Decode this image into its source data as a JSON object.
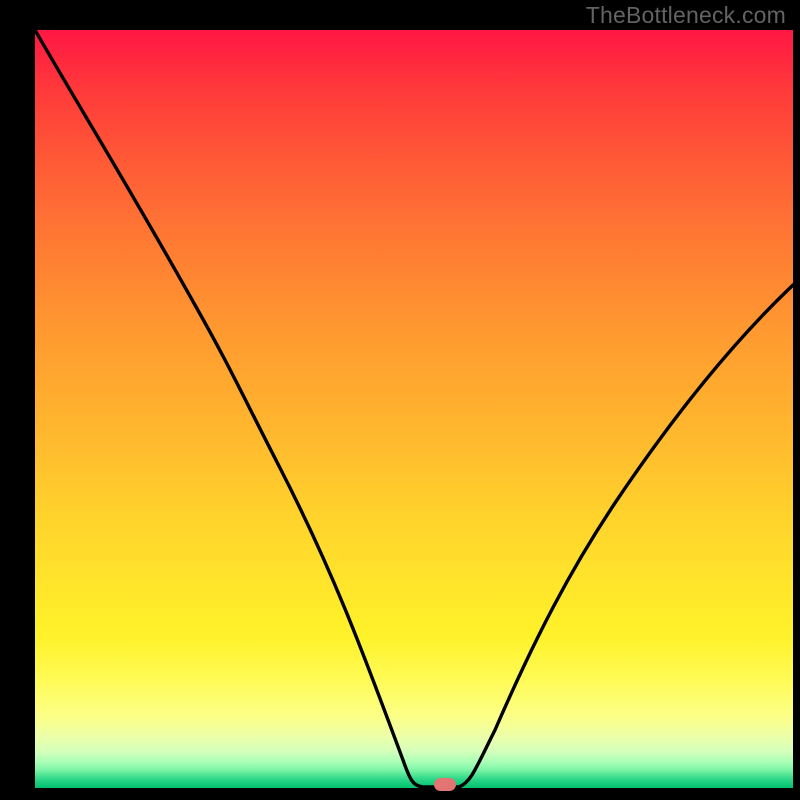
{
  "attribution": "TheBottleneck.com",
  "colors": {
    "page_bg": "#000000",
    "curve": "#000000",
    "marker": "#e27472",
    "attr_text": "#636363"
  },
  "chart_data": {
    "type": "line",
    "title": "",
    "xlabel": "",
    "ylabel": "",
    "xlim": [
      0,
      100
    ],
    "ylim": [
      0,
      100
    ],
    "grid": false,
    "legend": false,
    "series": [
      {
        "name": "bottleneck-curve",
        "x": [
          0,
          8,
          16,
          24,
          28,
          34,
          40,
          45,
          49,
          51,
          53,
          55,
          57,
          62,
          68,
          74,
          80,
          86,
          92,
          100
        ],
        "y": [
          100,
          88,
          76,
          64,
          57,
          48,
          36,
          22,
          6,
          1,
          0,
          0,
          2,
          12,
          24,
          35,
          44,
          51,
          58,
          66
        ]
      }
    ],
    "marker": {
      "x": 54,
      "y": 0.5,
      "shape": "rounded-rect",
      "color": "#e27472"
    },
    "annotations": []
  }
}
